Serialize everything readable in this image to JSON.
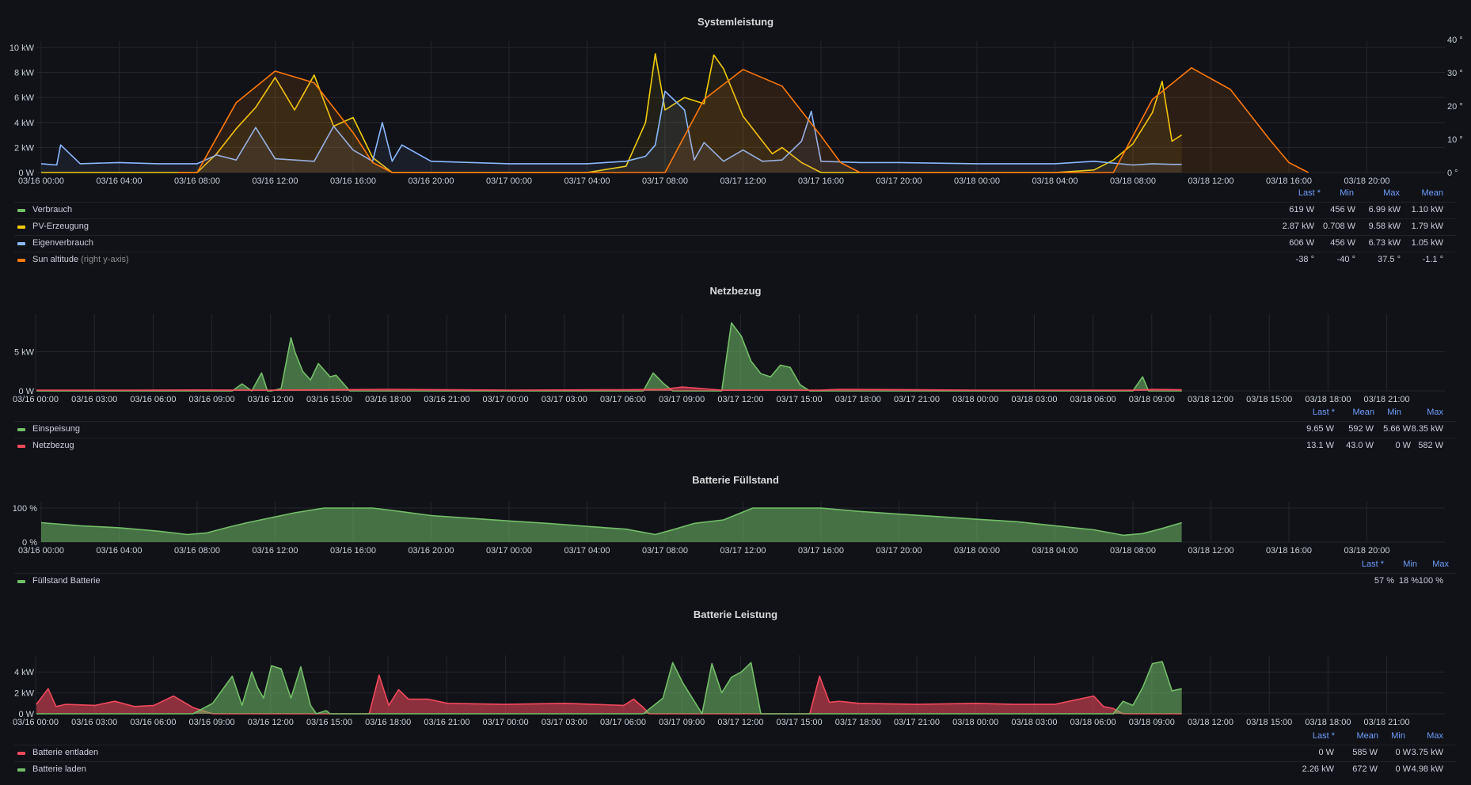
{
  "colors": {
    "background": "#111217",
    "grid": "#24262b",
    "green": "#73bf69",
    "yellow": "#f2cc0c",
    "blue": "#8ab8ff",
    "orange": "#ff780a",
    "red": "#f2495c",
    "legend_header": "#6e9fff"
  },
  "panels": {
    "system": {
      "title": "Systemleistung",
      "y_ticks": [
        "10 kW",
        "8 kW",
        "6 kW",
        "4 kW",
        "2 kW",
        "0 W"
      ],
      "y2_ticks": [
        "40 °",
        "30 °",
        "20 °",
        "10 °",
        "0 °"
      ],
      "x_ticks": [
        "03/16 00:00",
        "03/16 04:00",
        "03/16 08:00",
        "03/16 12:00",
        "03/16 16:00",
        "03/16 20:00",
        "03/17 00:00",
        "03/17 04:00",
        "03/17 08:00",
        "03/17 12:00",
        "03/17 16:00",
        "03/17 20:00",
        "03/18 00:00",
        "03/18 04:00",
        "03/18 08:00",
        "03/18 12:00",
        "03/18 16:00",
        "03/18 20:00"
      ],
      "legend_headers": [
        "Last *",
        "Min",
        "Max",
        "Mean"
      ],
      "series": [
        {
          "name": "Verbrauch",
          "hint": "",
          "color": "#73bf69",
          "values": [
            "619 W",
            "456 W",
            "6.99 kW",
            "1.10 kW"
          ]
        },
        {
          "name": "PV-Erzeugung",
          "hint": "",
          "color": "#f2cc0c",
          "values": [
            "2.87 kW",
            "0.708 W",
            "9.58 kW",
            "1.79 kW"
          ]
        },
        {
          "name": "Eigenverbrauch",
          "hint": "",
          "color": "#8ab8ff",
          "values": [
            "606 W",
            "456 W",
            "6.73 kW",
            "1.05 kW"
          ]
        },
        {
          "name": "Sun altitude",
          "hint": "(right y-axis)",
          "color": "#ff780a",
          "values": [
            "-38 °",
            "-40 °",
            "37.5 °",
            "-1.1 °"
          ]
        }
      ]
    },
    "grid": {
      "title": "Netzbezug",
      "y_ticks": [
        "5 kW",
        "0 W"
      ],
      "x_ticks": [
        "03/16 00:00",
        "03/16 03:00",
        "03/16 06:00",
        "03/16 09:00",
        "03/16 12:00",
        "03/16 15:00",
        "03/16 18:00",
        "03/16 21:00",
        "03/17 00:00",
        "03/17 03:00",
        "03/17 06:00",
        "03/17 09:00",
        "03/17 12:00",
        "03/17 15:00",
        "03/17 18:00",
        "03/17 21:00",
        "03/18 00:00",
        "03/18 03:00",
        "03/18 06:00",
        "03/18 09:00",
        "03/18 12:00",
        "03/18 15:00",
        "03/18 18:00",
        "03/18 21:00"
      ],
      "legend_headers": [
        "Last *",
        "Mean",
        "Min",
        "Max"
      ],
      "series": [
        {
          "name": "Einspeisung",
          "color": "#73bf69",
          "values": [
            "9.65 W",
            "592 W",
            "5.66 W",
            "8.35 kW"
          ]
        },
        {
          "name": "Netzbezug",
          "color": "#f2495c",
          "values": [
            "13.1 W",
            "43.0 W",
            "0 W",
            "582 W"
          ]
        }
      ]
    },
    "battery_level": {
      "title": "Batterie Füllstand",
      "y_ticks": [
        "100 %",
        "0 %"
      ],
      "x_ticks": [
        "03/16 00:00",
        "03/16 04:00",
        "03/16 08:00",
        "03/16 12:00",
        "03/16 16:00",
        "03/16 20:00",
        "03/17 00:00",
        "03/17 04:00",
        "03/17 08:00",
        "03/17 12:00",
        "03/17 16:00",
        "03/17 20:00",
        "03/18 00:00",
        "03/18 04:00",
        "03/18 08:00",
        "03/18 12:00",
        "03/18 16:00",
        "03/18 20:00"
      ],
      "legend_headers": [
        "Last *",
        "Min",
        "Max"
      ],
      "series": [
        {
          "name": "Füllstand Batterie",
          "color": "#73bf69",
          "values": [
            "57 %",
            "18 %",
            "100 %"
          ]
        }
      ]
    },
    "battery_power": {
      "title": "Batterie Leistung",
      "y_ticks": [
        "4 kW",
        "2 kW",
        "0 W"
      ],
      "x_ticks": [
        "03/16 00:00",
        "03/16 03:00",
        "03/16 06:00",
        "03/16 09:00",
        "03/16 12:00",
        "03/16 15:00",
        "03/16 18:00",
        "03/16 21:00",
        "03/17 00:00",
        "03/17 03:00",
        "03/17 06:00",
        "03/17 09:00",
        "03/17 12:00",
        "03/17 15:00",
        "03/17 18:00",
        "03/17 21:00",
        "03/18 00:00",
        "03/18 03:00",
        "03/18 06:00",
        "03/18 09:00",
        "03/18 12:00",
        "03/18 15:00",
        "03/18 18:00",
        "03/18 21:00"
      ],
      "legend_headers": [
        "Last *",
        "Mean",
        "Min",
        "Max"
      ],
      "series": [
        {
          "name": "Batterie entladen",
          "color": "#f2495c",
          "values": [
            "0 W",
            "585 W",
            "0 W",
            "3.75 kW"
          ]
        },
        {
          "name": "Batterie laden",
          "color": "#73bf69",
          "values": [
            "2.26 kW",
            "672 W",
            "0 W",
            "4.98 kW"
          ]
        }
      ]
    }
  },
  "chart_data": [
    {
      "type": "line",
      "title": "Systemleistung",
      "x_unit": "hours since 03/16 00:00",
      "ylim": [
        0,
        10000
      ],
      "y2lim": [
        0,
        40
      ],
      "series": [
        {
          "name": "PV-Erzeugung",
          "axis": "left",
          "x": [
            0,
            8,
            9,
            10,
            11,
            12,
            13,
            14,
            15,
            16,
            17,
            18,
            20,
            24,
            28,
            30,
            31,
            31.5,
            32,
            33,
            34,
            34.5,
            35,
            36,
            37,
            37.5,
            38,
            39,
            40,
            41,
            42,
            44,
            48,
            52,
            54,
            55,
            56,
            57,
            57.5,
            58,
            58.5
          ],
          "y": [
            0,
            0,
            1500,
            3500,
            5200,
            7600,
            5000,
            7800,
            3700,
            4400,
            1200,
            0,
            0,
            0,
            0,
            500,
            4000,
            9500,
            5000,
            6000,
            5500,
            9400,
            8300,
            4500,
            2500,
            1500,
            2000,
            800,
            0,
            0,
            0,
            0,
            0,
            0,
            200,
            1000,
            2300,
            4800,
            7300,
            2500,
            3000
          ]
        },
        {
          "name": "Eigenverbrauch",
          "axis": "left",
          "x": [
            0,
            0.8,
            1,
            2,
            4,
            6,
            8,
            9,
            10,
            11,
            12,
            13,
            14,
            15,
            16,
            17,
            17.5,
            18,
            18.5,
            20,
            24,
            28,
            30,
            31,
            31.5,
            32,
            33,
            33.5,
            34,
            35,
            36,
            37,
            38,
            39,
            39.5,
            40,
            42,
            44,
            48,
            52,
            54,
            56,
            57,
            58,
            58.5
          ],
          "y": [
            700,
            600,
            2200,
            700,
            800,
            700,
            700,
            1400,
            1000,
            3600,
            1100,
            1000,
            900,
            3700,
            1800,
            900,
            4000,
            900,
            2200,
            900,
            700,
            700,
            900,
            1300,
            2200,
            6500,
            5000,
            1000,
            2400,
            900,
            1800,
            900,
            1000,
            2500,
            4900,
            900,
            800,
            800,
            700,
            700,
            900,
            600,
            700,
            650,
            650
          ]
        },
        {
          "name": "Sun altitude",
          "axis": "right",
          "x": [
            7,
            8,
            10,
            12,
            14,
            16,
            17,
            18,
            31,
            32,
            34,
            36,
            38,
            40,
            41,
            42,
            54,
            55,
            57,
            59,
            61,
            63,
            64,
            65
          ],
          "y": [
            -5,
            0,
            21,
            30.5,
            27,
            12,
            3,
            -3,
            -5,
            0,
            22,
            31,
            26,
            11,
            3,
            -3,
            -5,
            0,
            22,
            31.5,
            25,
            10,
            3,
            -3
          ]
        }
      ]
    },
    {
      "type": "area",
      "title": "Netzbezug",
      "x_unit": "hours since 03/16 00:00",
      "ylim": [
        0,
        9000
      ],
      "series": [
        {
          "name": "Einspeisung",
          "x": [
            0,
            10,
            10.5,
            11,
            11.5,
            11.8,
            12,
            12.5,
            13,
            13.2,
            13.6,
            14,
            14.4,
            15,
            15.3,
            15.8,
            16,
            16.4,
            17,
            17.5,
            18,
            31,
            31.5,
            32,
            32.5,
            33,
            33.5,
            35,
            35.5,
            36,
            36.5,
            37,
            37.5,
            38,
            38.5,
            39,
            39.5,
            40,
            41,
            56,
            56.5,
            56.8,
            57,
            58.5
          ],
          "y": [
            0,
            0,
            900,
            0,
            2300,
            0,
            0,
            300,
            6800,
            5000,
            2500,
            1400,
            3500,
            1800,
            2000,
            600,
            0,
            0,
            0,
            0,
            0,
            0,
            2300,
            1000,
            0,
            0,
            0,
            0,
            8700,
            7000,
            3800,
            2200,
            1800,
            3300,
            3000,
            800,
            0,
            0,
            0,
            0,
            1800,
            0,
            0,
            0
          ]
        },
        {
          "name": "Netzbezug",
          "x": [
            0,
            5,
            8,
            12,
            18,
            24,
            30,
            32,
            33,
            35,
            40,
            41,
            48,
            56,
            57,
            58.5
          ],
          "y": [
            100,
            100,
            120,
            100,
            200,
            100,
            150,
            200,
            500,
            100,
            100,
            200,
            100,
            100,
            200,
            150
          ]
        }
      ]
    },
    {
      "type": "area",
      "title": "Batterie Füllstand",
      "x_unit": "hours since 03/16 00:00",
      "ylim": [
        0,
        100
      ],
      "series": [
        {
          "name": "Füllstand Batterie",
          "x": [
            0,
            2,
            4,
            6,
            7.5,
            8.5,
            9.5,
            10.5,
            12,
            13,
            14.5,
            16,
            17,
            18,
            20,
            22,
            24,
            26,
            28,
            30,
            31.5,
            32.5,
            33.5,
            35,
            36.5,
            38.5,
            40,
            42,
            44,
            46,
            48,
            50,
            52,
            54,
            55.5,
            56.5,
            57.5,
            58.5
          ],
          "y": [
            57,
            48,
            42,
            32,
            22,
            27,
            42,
            56,
            74,
            86,
            100,
            100,
            100,
            93,
            78,
            70,
            62,
            55,
            46,
            38,
            22,
            38,
            55,
            65,
            100,
            100,
            100,
            90,
            82,
            75,
            67,
            60,
            48,
            36,
            20,
            25,
            40,
            57
          ]
        }
      ]
    },
    {
      "type": "area",
      "title": "Batterie Leistung",
      "x_unit": "hours since 03/16 00:00",
      "ylim": [
        0,
        5000
      ],
      "series": [
        {
          "name": "Batterie entladen",
          "x": [
            0,
            0.6,
            1,
            1.5,
            3,
            4,
            5,
            6,
            7,
            8,
            9,
            17,
            17.5,
            18,
            18.5,
            19,
            20,
            21,
            24,
            27,
            30,
            30.5,
            31,
            31.3,
            39.5,
            40,
            40.5,
            41,
            42,
            45,
            48,
            50,
            52,
            53,
            54,
            54.5,
            55,
            55.5,
            58.5
          ],
          "y": [
            900,
            2400,
            700,
            900,
            800,
            1200,
            700,
            800,
            1700,
            600,
            0,
            0,
            3700,
            800,
            2300,
            1400,
            1400,
            1000,
            900,
            1000,
            800,
            1400,
            600,
            0,
            0,
            3600,
            1100,
            1200,
            1000,
            900,
            1000,
            900,
            900,
            1300,
            1700,
            700,
            500,
            0,
            0
          ]
        },
        {
          "name": "Batterie laden",
          "x": [
            0,
            8,
            9,
            10,
            10.5,
            11,
            11.3,
            11.6,
            12,
            12.5,
            13,
            13.5,
            14,
            14.3,
            14.8,
            15,
            30,
            31,
            32,
            32.5,
            33,
            34,
            34.5,
            35,
            35.5,
            36,
            36.5,
            37,
            37.5,
            38,
            39,
            55,
            55.5,
            56,
            56.5,
            57,
            57.5,
            58,
            58.5
          ],
          "y": [
            0,
            0,
            1000,
            3600,
            800,
            4000,
            2500,
            1500,
            4600,
            4300,
            1500,
            4500,
            800,
            0,
            300,
            0,
            0,
            0,
            1500,
            4900,
            3000,
            0,
            4800,
            2000,
            3500,
            4000,
            4900,
            0,
            0,
            0,
            0,
            0,
            1200,
            800,
            2500,
            4800,
            5000,
            2200,
            2400
          ]
        }
      ]
    }
  ]
}
